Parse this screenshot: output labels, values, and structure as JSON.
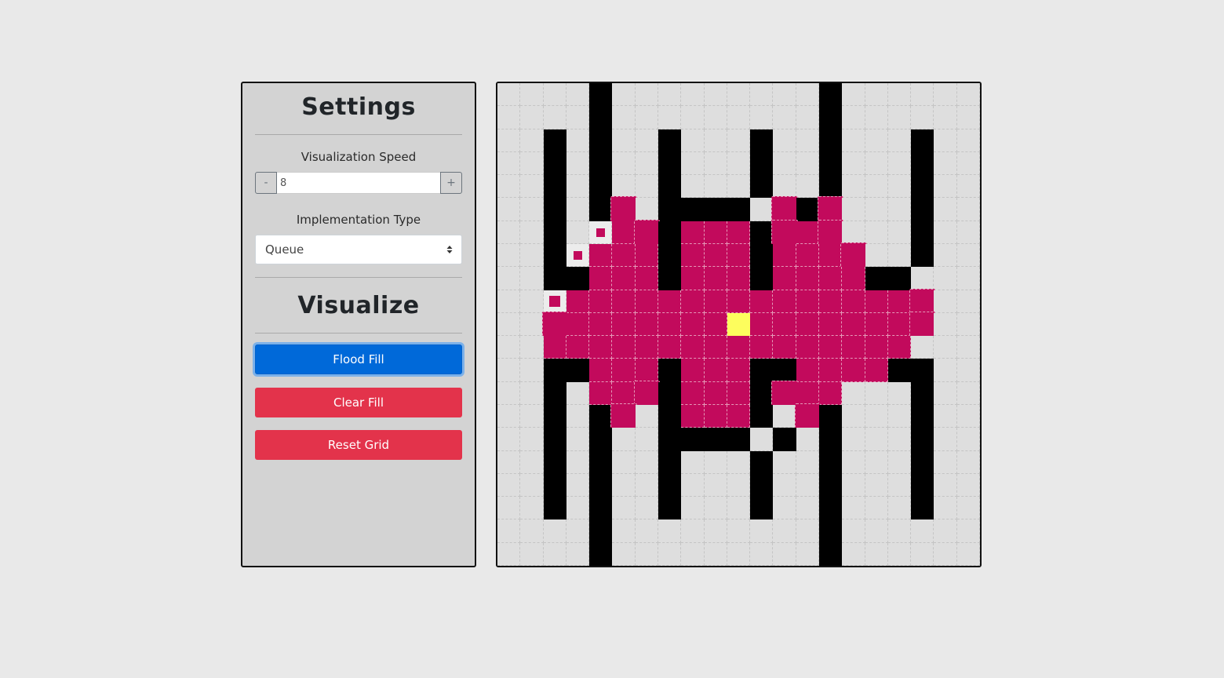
{
  "settings": {
    "title": "Settings",
    "speed_label": "Visualization Speed",
    "speed_value": "8",
    "decrement_label": "-",
    "increment_label": "+",
    "impl_label": "Implementation Type",
    "impl_selected": "Queue"
  },
  "visualize": {
    "title": "Visualize",
    "flood_fill_label": "Flood Fill",
    "clear_fill_label": "Clear Fill",
    "reset_grid_label": "Reset Grid"
  },
  "colors": {
    "wall": "#000000",
    "empty": "#dedede",
    "filled": "#c20a5c",
    "start": "#fdfd5d",
    "primary": "#0069d9",
    "danger": "#e3334b"
  },
  "grid": {
    "rows": 21,
    "cols": 21,
    "legend": "# wall, . empty, F filled, S start, v visiting, g growing",
    "cells": [
      "....#.........#......",
      "....#.........#......",
      "..#.#..#...#..#...#..",
      "..#.#..#...#..#...#..",
      "..#.#..#...#..#...#..",
      "..#.#g.####.g#g...#..",
      "..#.vFg#FFF#gFg...#..",
      "..#vFFF#FFF#FFFg..#..",
      "..##FFF#FFF#FFFF##...",
      "..vFFFFFFFFFFFFFFFg..",
      "..gFFFFFFFSFFFFFFFg..",
      "..FFFFFFFFFFFFFFFF...",
      "..##FFF#FFF##FFFF##..",
      "..#.FFg#FFF#gFF...#..",
      "..#.#g.#FFF#.g#...#..",
      "..#.#..####.#.#...#..",
      "..#.#..#...#..#...#..",
      "..#.#..#...#..#...#..",
      "..#.#..#...#..#...#..",
      "....#.........#......",
      "....#.........#......"
    ]
  }
}
